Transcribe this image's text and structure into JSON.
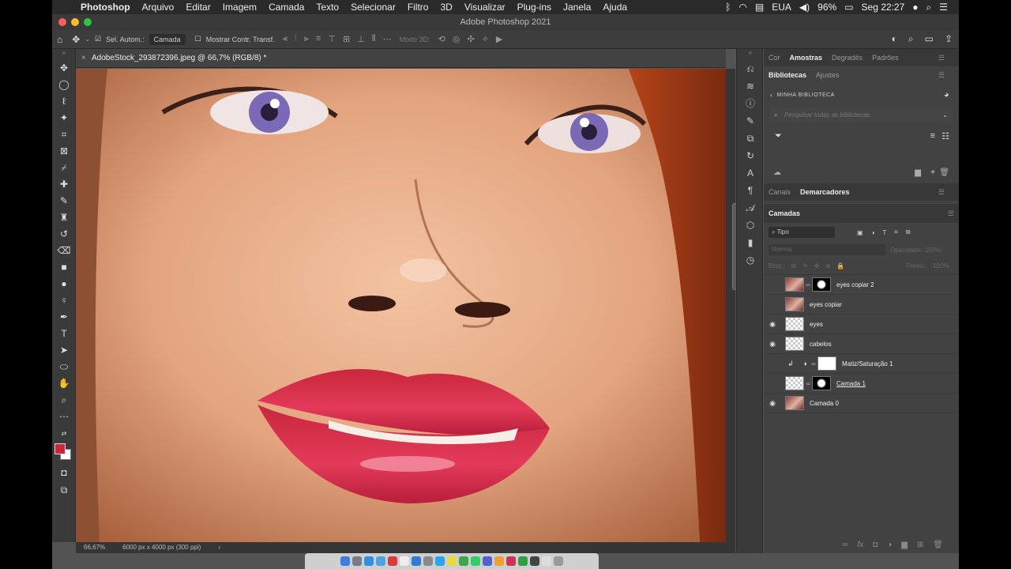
{
  "menubar": {
    "app": "Photoshop",
    "items": [
      "Arquivo",
      "Editar",
      "Imagem",
      "Camada",
      "Texto",
      "Selecionar",
      "Filtro",
      "3D",
      "Visualizar",
      "Plug-ins",
      "Janela",
      "Ajuda"
    ],
    "keyboard": "EUA",
    "battery": "96%",
    "clock": "Seg 22:27"
  },
  "window": {
    "title": "Adobe Photoshop 2021"
  },
  "options": {
    "auto_select_label": "Sel. Autom.:",
    "auto_select_value": "Camada",
    "show_transform_label": "Mostrar Contr. Transf.",
    "mode3d_label": "Modo 3D:"
  },
  "document": {
    "tab_title": "AdobeStock_293872396.jpeg @ 66,7% (RGB/8) *",
    "zoom": "66,67%",
    "dimensions": "6000 px x 4000 px (300 ppi)"
  },
  "panels": {
    "top_tabs": [
      "Cor",
      "Amostras",
      "Degradês",
      "Padrões"
    ],
    "top_active": "Amostras",
    "lib_tabs": [
      "Bibliotecas",
      "Ajustes"
    ],
    "lib_active": "Bibliotecas",
    "library_name": "MINHA BIBLIOTECA",
    "search_placeholder": "Pesquisar todas as bibliotecas",
    "mid_tabs": [
      "Canais",
      "Demarcadores"
    ],
    "mid_active": "Demarcadores",
    "layers_title": "Camadas",
    "kind_filter": "Tipo",
    "blend_mode": "Normal",
    "opacity_label": "Opacidade:",
    "opacity_value": "100%",
    "lock_label": "Bloq.:",
    "fill_label": "Preen.:",
    "fill_value": "100%"
  },
  "layers": [
    {
      "name": "eyes copiar 2",
      "visible": false,
      "thumb": "photo",
      "mask": true
    },
    {
      "name": "eyes copiar",
      "visible": false,
      "thumb": "photo",
      "mask": false
    },
    {
      "name": "eyes",
      "visible": true,
      "thumb": "checker",
      "mask": false
    },
    {
      "name": "cabelos",
      "visible": true,
      "thumb": "checker",
      "mask": false
    },
    {
      "name": "Matiz/Saturação 1",
      "visible": false,
      "thumb": "white",
      "mask": false,
      "adjustment": true
    },
    {
      "name": "Camada 1",
      "visible": false,
      "thumb": "checker",
      "mask": true
    },
    {
      "name": "Camada 0",
      "visible": true,
      "thumb": "photo",
      "mask": false
    }
  ],
  "colors": {
    "foreground": "#c8283c",
    "background": "#ffffff"
  }
}
